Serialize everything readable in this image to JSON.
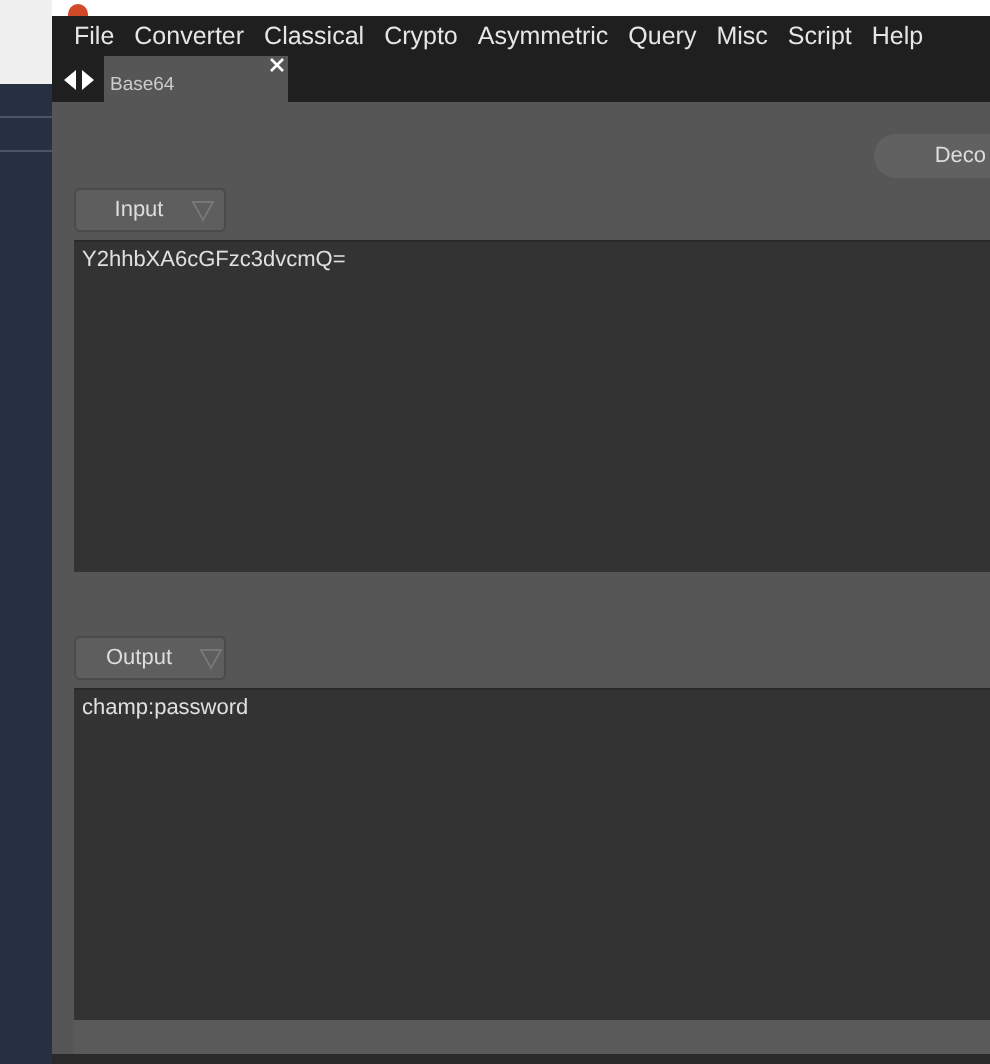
{
  "menu_bar": [
    "File",
    "Converter",
    "Classical",
    "Crypto",
    "Asymmetric",
    "Query",
    "Misc",
    "Script",
    "Help"
  ],
  "tabs": [
    {
      "label": "Base64",
      "selected": true
    }
  ],
  "decode_button": "Deco",
  "input": {
    "label": "Input",
    "value": "Y2hhbXA6cGFzc3dvcmQ="
  },
  "output": {
    "label": "Output",
    "value": "champ:password"
  }
}
